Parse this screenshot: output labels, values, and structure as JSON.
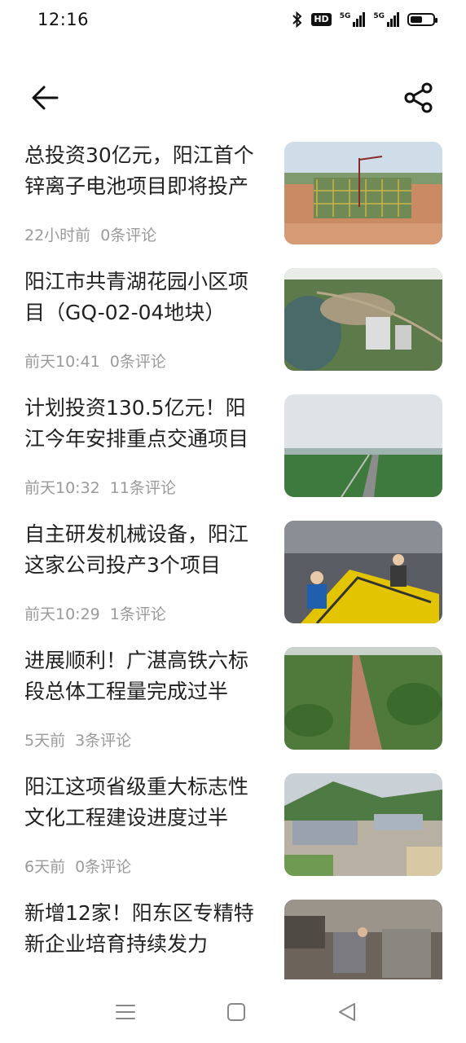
{
  "status_bar": {
    "time": "12:16",
    "hd_label": "HD",
    "network_label_1": "5G",
    "network_label_2": "5G",
    "battery_level": 0.6
  },
  "header": {
    "back_icon": "arrow-left-icon",
    "share_icon": "share-icon"
  },
  "articles": [
    {
      "title": "总投资30亿元，阳江首个锌离子电池项目即将投产",
      "time": "22小时前",
      "comments": "0条评论",
      "image": "construction-site"
    },
    {
      "title": "阳江市共青湖花园小区项目（GQ-02-04地块）",
      "time": "前天10:41",
      "comments": "0条评论",
      "image": "lake-aerial"
    },
    {
      "title": "计划投资130.5亿元！阳江今年安排重点交通项目",
      "time": "前天10:32",
      "comments": "11条评论",
      "image": "highway-landscape"
    },
    {
      "title": "自主研发机械设备，阳江这家公司投产3个项目",
      "time": "前天10:29",
      "comments": "1条评论",
      "image": "factory-workers"
    },
    {
      "title": "进展顺利！广湛高铁六标段总体工程量完成过半",
      "time": "5天前",
      "comments": "3条评论",
      "image": "railway-aerial"
    },
    {
      "title": "阳江这项省级重大标志性文化工程建设进度过半",
      "time": "6天前",
      "comments": "0条评论",
      "image": "cultural-building"
    },
    {
      "title": "新增12家！阳东区专精特新企业培育持续发力",
      "time": "",
      "comments": "",
      "image": "workshop"
    }
  ],
  "nav_bar": {
    "menu_icon": "menu-icon",
    "home_icon": "home-icon",
    "back_icon": "back-triangle-icon"
  }
}
